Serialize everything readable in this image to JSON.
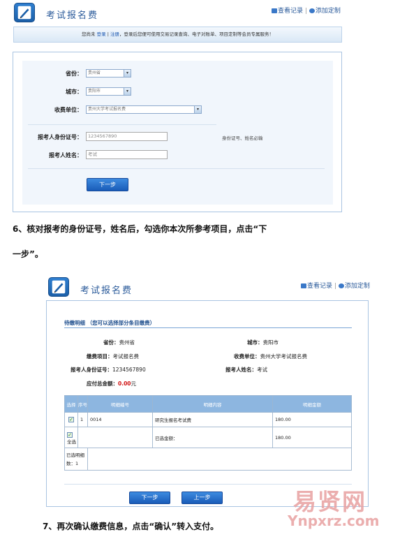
{
  "screen1": {
    "title": "考试报名费",
    "link_records": "查看记录",
    "link_sep": "|",
    "link_custom": "添加定制",
    "notice_prefix": "您尚未",
    "notice_login": "登录",
    "notice_sep": "|",
    "notice_register": "注册",
    "notice_suffix": "，登录后您便可使用交易记录查询、电子对账单、项目定制等会员专属服务！",
    "province_label": "省份：",
    "province_value": "贵州省",
    "city_label": "城市：",
    "city_value": "贵阳市",
    "unit_label": "收费单位：",
    "unit_value": "贵州大学考试报名费",
    "id_label": "报考人身份证号：",
    "id_value": "1234567890",
    "id_hint": "身份证号、姓名必输",
    "name_label": "报考人姓名：",
    "name_value": "考试",
    "next_button": "下一步"
  },
  "instruction_6_line1": "6、核对报考的身份证号，姓名后，勾选你本次所参考项目，点击“下",
  "instruction_6_line2": "一步”。",
  "screen2": {
    "title": "考试报名费",
    "link_records": "查看记录",
    "link_sep": "|",
    "link_custom": "添加定制",
    "section_title": "待缴明细 （您可以选择部分条目缴费）",
    "province_label": "省份：",
    "province_value": "贵州省",
    "city_label": "城市：",
    "city_value": "贵阳市",
    "item_label": "缴费项目：",
    "item_value": "考试报名费",
    "unit_label": "收费单位：",
    "unit_value": "贵州大学考试报名费",
    "id_label": "报考人身份证号：",
    "id_value": "1234567890",
    "name_label": "报考人姓名：",
    "name_value": "考试",
    "total_label": "应付总金额：",
    "total_value": "0.00",
    "total_unit": "元",
    "table": {
      "headers": [
        "选择",
        "序号",
        "明细编号",
        "明细内容",
        "明细金额"
      ],
      "row": {
        "seq": "1",
        "code": "0014",
        "content": "研究生报名考试费",
        "amount": "180.00"
      },
      "select_all_label": "全选",
      "selected_amount_label": "已选金额：",
      "selected_amount_value": "180.00",
      "selected_count_label": "已选明细数：1"
    },
    "next_button": "下一步",
    "prev_button": "上一步"
  },
  "instruction_7": "7、再次确认缴费信息，点击“确认”转入支付。",
  "watermark": {
    "line1": "易贤网",
    "line2": "Ynpxrz.com"
  },
  "colors": {
    "accent": "#1a5cb8",
    "header_blue": "#8db6e0",
    "total_red": "#d01010"
  }
}
